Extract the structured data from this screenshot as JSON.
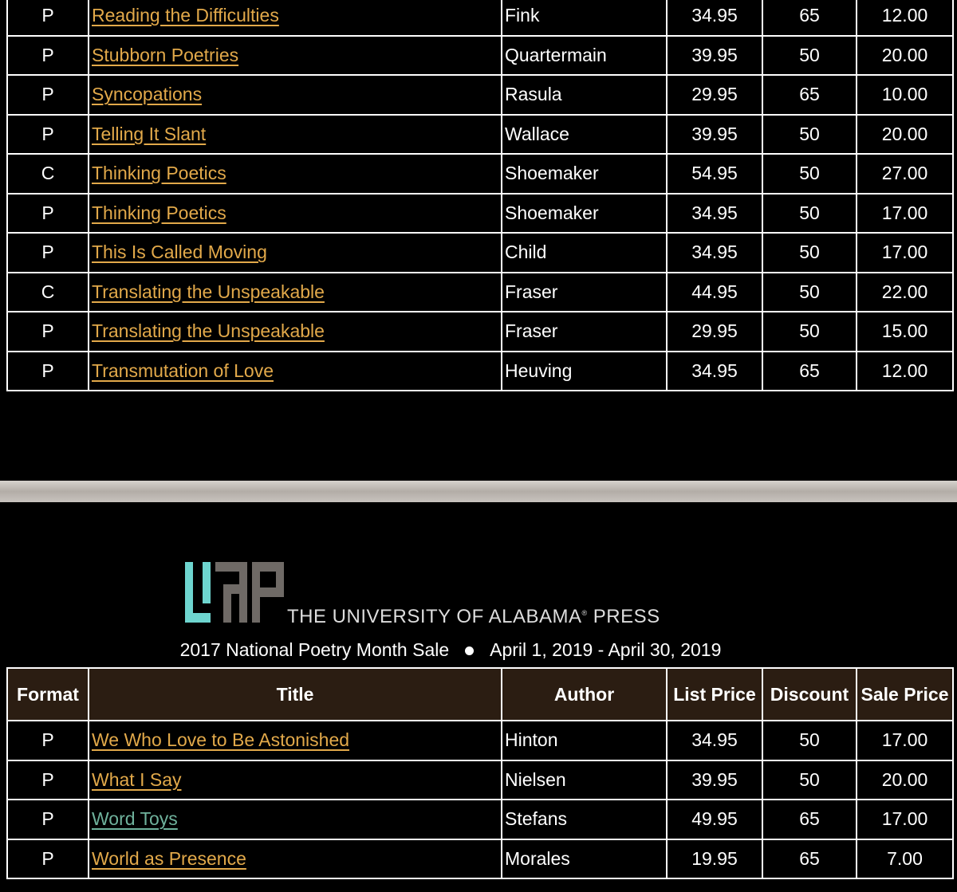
{
  "colors": {
    "link": "#e2a94a",
    "visited_link": "#6fb29c",
    "header_bg": "#2b1d12",
    "logo_u": "#6ed5cf",
    "logo_ap": "#6f6a66"
  },
  "table_top": {
    "rows": [
      {
        "format": "P",
        "title": "Reading the Difficulties",
        "author": "Fink",
        "list_price": "34.95",
        "discount": "65",
        "sale_price": "12.00"
      },
      {
        "format": "P",
        "title": "Stubborn Poetries",
        "author": "Quartermain",
        "list_price": "39.95",
        "discount": "50",
        "sale_price": "20.00"
      },
      {
        "format": "P",
        "title": "Syncopations",
        "author": "Rasula",
        "list_price": "29.95",
        "discount": "65",
        "sale_price": "10.00"
      },
      {
        "format": "P",
        "title": "Telling It Slant",
        "author": "Wallace",
        "list_price": "39.95",
        "discount": "50",
        "sale_price": "20.00"
      },
      {
        "format": "C",
        "title": "Thinking Poetics",
        "author": "Shoemaker",
        "list_price": "54.95",
        "discount": "50",
        "sale_price": "27.00"
      },
      {
        "format": "P",
        "title": "Thinking Poetics",
        "author": "Shoemaker",
        "list_price": "34.95",
        "discount": "50",
        "sale_price": "17.00"
      },
      {
        "format": "P",
        "title": "This Is Called Moving",
        "author": "Child",
        "list_price": "34.95",
        "discount": "50",
        "sale_price": "17.00"
      },
      {
        "format": "C",
        "title": "Translating the Unspeakable",
        "author": "Fraser",
        "list_price": "44.95",
        "discount": "50",
        "sale_price": "22.00"
      },
      {
        "format": "P",
        "title": "Translating the Unspeakable",
        "author": "Fraser",
        "list_price": "29.95",
        "discount": "50",
        "sale_price": "15.00"
      },
      {
        "format": "P",
        "title": "Transmutation of Love",
        "author": "Heuving",
        "list_price": "34.95",
        "discount": "65",
        "sale_price": "12.00"
      }
    ]
  },
  "logo": {
    "mark": "UAP",
    "press_name": "THE UNIVERSITY OF ALABAMA",
    "registered": "®",
    "press_suffix": "PRESS"
  },
  "sale": {
    "name": "2017 National Poetry Month Sale",
    "dates": "April 1, 2019 - April 30, 2019"
  },
  "table_bottom": {
    "headers": {
      "format": "Format",
      "title": "Title",
      "author": "Author",
      "list_price": "List Price",
      "discount": "Discount",
      "sale_price": "Sale Price"
    },
    "rows": [
      {
        "format": "P",
        "title": "We Who Love to Be Astonished",
        "author": "Hinton",
        "list_price": "34.95",
        "discount": "50",
        "sale_price": "17.00"
      },
      {
        "format": "P",
        "title": "What I Say",
        "author": "Nielsen",
        "list_price": "39.95",
        "discount": "50",
        "sale_price": "20.00"
      },
      {
        "format": "P",
        "title": "Word Toys",
        "author": "Stefans",
        "list_price": "49.95",
        "discount": "65",
        "sale_price": "17.00",
        "visited": true
      },
      {
        "format": "P",
        "title": "World as Presence",
        "author": "Morales",
        "list_price": "19.95",
        "discount": "65",
        "sale_price": "7.00"
      }
    ]
  }
}
